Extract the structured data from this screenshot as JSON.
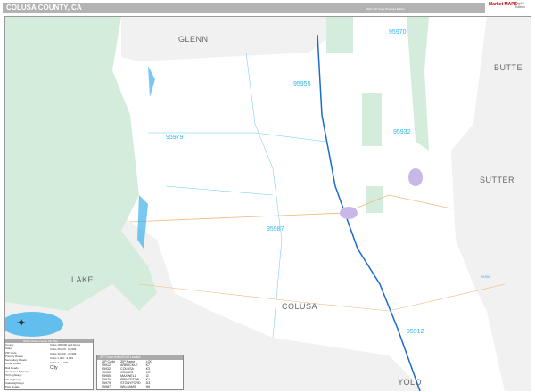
{
  "header": {
    "title": "COLUSA COUNTY, CA",
    "edition": "2021 ZIP Code Premium Edition",
    "logo_text": "Market MAPS",
    "logo_side": "Digital Edition"
  },
  "regions": {
    "glenn": "GLENN",
    "butte": "BUTTE",
    "sutter": "SUTTER",
    "lake": "LAKE",
    "colusa": "COLUSA",
    "yolo": "YOLO"
  },
  "zips": {
    "z95970": "95970",
    "z95955": "95955",
    "z95979": "95979",
    "z95932": "95932",
    "z95987": "95987",
    "z95912": "95912",
    "z95950": "95950"
  },
  "legend": {
    "title": "2021 Colusa County Zip Map",
    "items": [
      "County",
      "State",
      "ZIP Code",
      "Primary Roads",
      "Secondary Roads",
      "Urban Roads",
      "Rail Roads",
      "Interstate Highways",
      "Toll Highways",
      "US Highways",
      "State Highways",
      "Park Roads"
    ],
    "cities": [
      "Cities 100,000 and Above",
      "Cities 25,000 - 99,999",
      "Cities 10,000 - 24,999",
      "Cities 1,000 - 9,999",
      "Cities 1 - 1,000"
    ],
    "city_marker": "City"
  },
  "index": {
    "title": "ZIP Code Index/Grid Locator",
    "headers": [
      "ZIP Code",
      "ZIP Name",
      "LOC"
    ],
    "rows": [
      [
        "95912",
        "ARBUCKLE",
        "K7"
      ],
      [
        "95932",
        "COLUSA",
        "K3"
      ],
      [
        "95950",
        "GRIMES",
        "M7"
      ],
      [
        "95955",
        "MAXWELL",
        "I2"
      ],
      [
        "95970",
        "PRINCETON",
        "K1"
      ],
      [
        "95979",
        "STONYFORD",
        "D3"
      ],
      [
        "95987",
        "WILLIAMS",
        "H6"
      ]
    ]
  },
  "colors": {
    "land": "#ffffff",
    "outside": "#f1f1f1",
    "park": "#d4ecdc",
    "water": "#3fb2ec",
    "zip_label": "#2fb4e8",
    "road": "#f0b87a"
  }
}
